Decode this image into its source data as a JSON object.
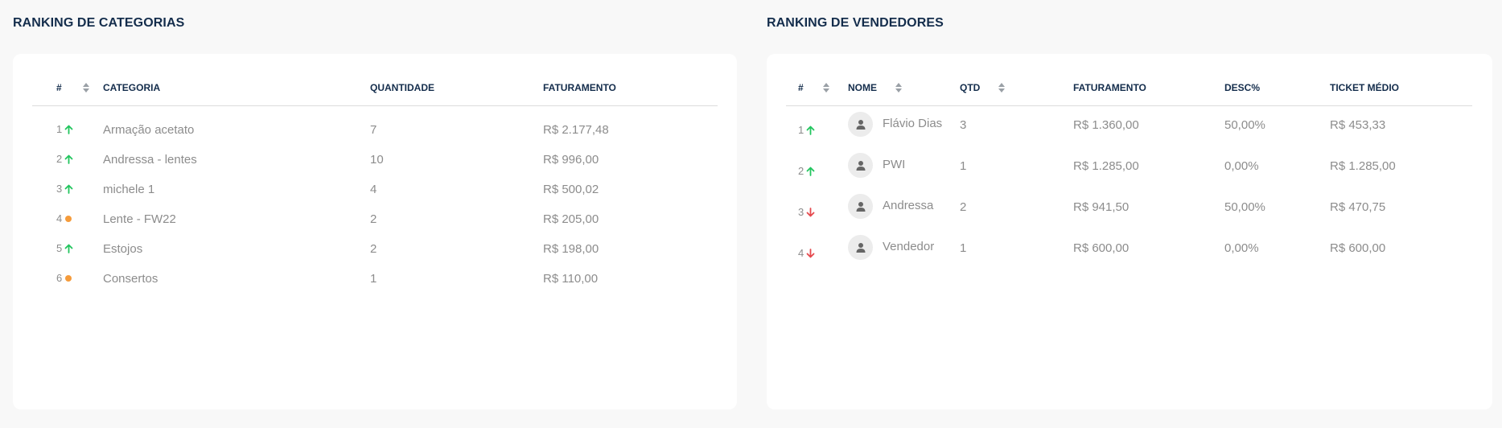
{
  "colors": {
    "title": "#142d4c",
    "up": "#22c55e",
    "down": "#e5484d",
    "neutral": "#f59b3b",
    "text": "#8c8c8c"
  },
  "categories": {
    "title": "RANKING DE CATEGORIAS",
    "headers": {
      "rank": "#",
      "category": "CATEGORIA",
      "quantity": "QUANTIDADE",
      "revenue": "FATURAMENTO"
    },
    "rows": [
      {
        "rank": "1",
        "trend": "up",
        "category": "Armação acetato",
        "quantity": "7",
        "revenue": "R$ 2.177,48"
      },
      {
        "rank": "2",
        "trend": "up",
        "category": "Andressa - lentes",
        "quantity": "10",
        "revenue": "R$ 996,00"
      },
      {
        "rank": "3",
        "trend": "up",
        "category": "michele 1",
        "quantity": "4",
        "revenue": "R$ 500,02"
      },
      {
        "rank": "4",
        "trend": "neutral",
        "category": "Lente - FW22",
        "quantity": "2",
        "revenue": "R$ 205,00"
      },
      {
        "rank": "5",
        "trend": "up",
        "category": "Estojos",
        "quantity": "2",
        "revenue": "R$ 198,00"
      },
      {
        "rank": "6",
        "trend": "neutral",
        "category": "Consertos",
        "quantity": "1",
        "revenue": "R$ 110,00"
      }
    ]
  },
  "sellers": {
    "title": "RANKING DE VENDEDORES",
    "headers": {
      "rank": "#",
      "name": "NOME",
      "qty": "QTD",
      "revenue": "FATURAMENTO",
      "discount": "DESC%",
      "ticket": "TICKET MÉDIO"
    },
    "rows": [
      {
        "rank": "1",
        "trend": "up",
        "name": "Flávio Dias",
        "qty": "3",
        "revenue": "R$ 1.360,00",
        "discount": "50,00%",
        "ticket": "R$ 453,33",
        "avatar_icon": "person-icon"
      },
      {
        "rank": "2",
        "trend": "up",
        "name": "PWI",
        "qty": "1",
        "revenue": "R$ 1.285,00",
        "discount": "0,00%",
        "ticket": "R$ 1.285,00",
        "avatar_icon": "person-icon"
      },
      {
        "rank": "3",
        "trend": "down",
        "name": "Andressa",
        "qty": "2",
        "revenue": "R$ 941,50",
        "discount": "50,00%",
        "ticket": "R$ 470,75",
        "avatar_icon": "person-icon"
      },
      {
        "rank": "4",
        "trend": "down",
        "name": "Vendedor",
        "qty": "1",
        "revenue": "R$ 600,00",
        "discount": "0,00%",
        "ticket": "R$ 600,00",
        "avatar_icon": "person-icon"
      }
    ]
  }
}
